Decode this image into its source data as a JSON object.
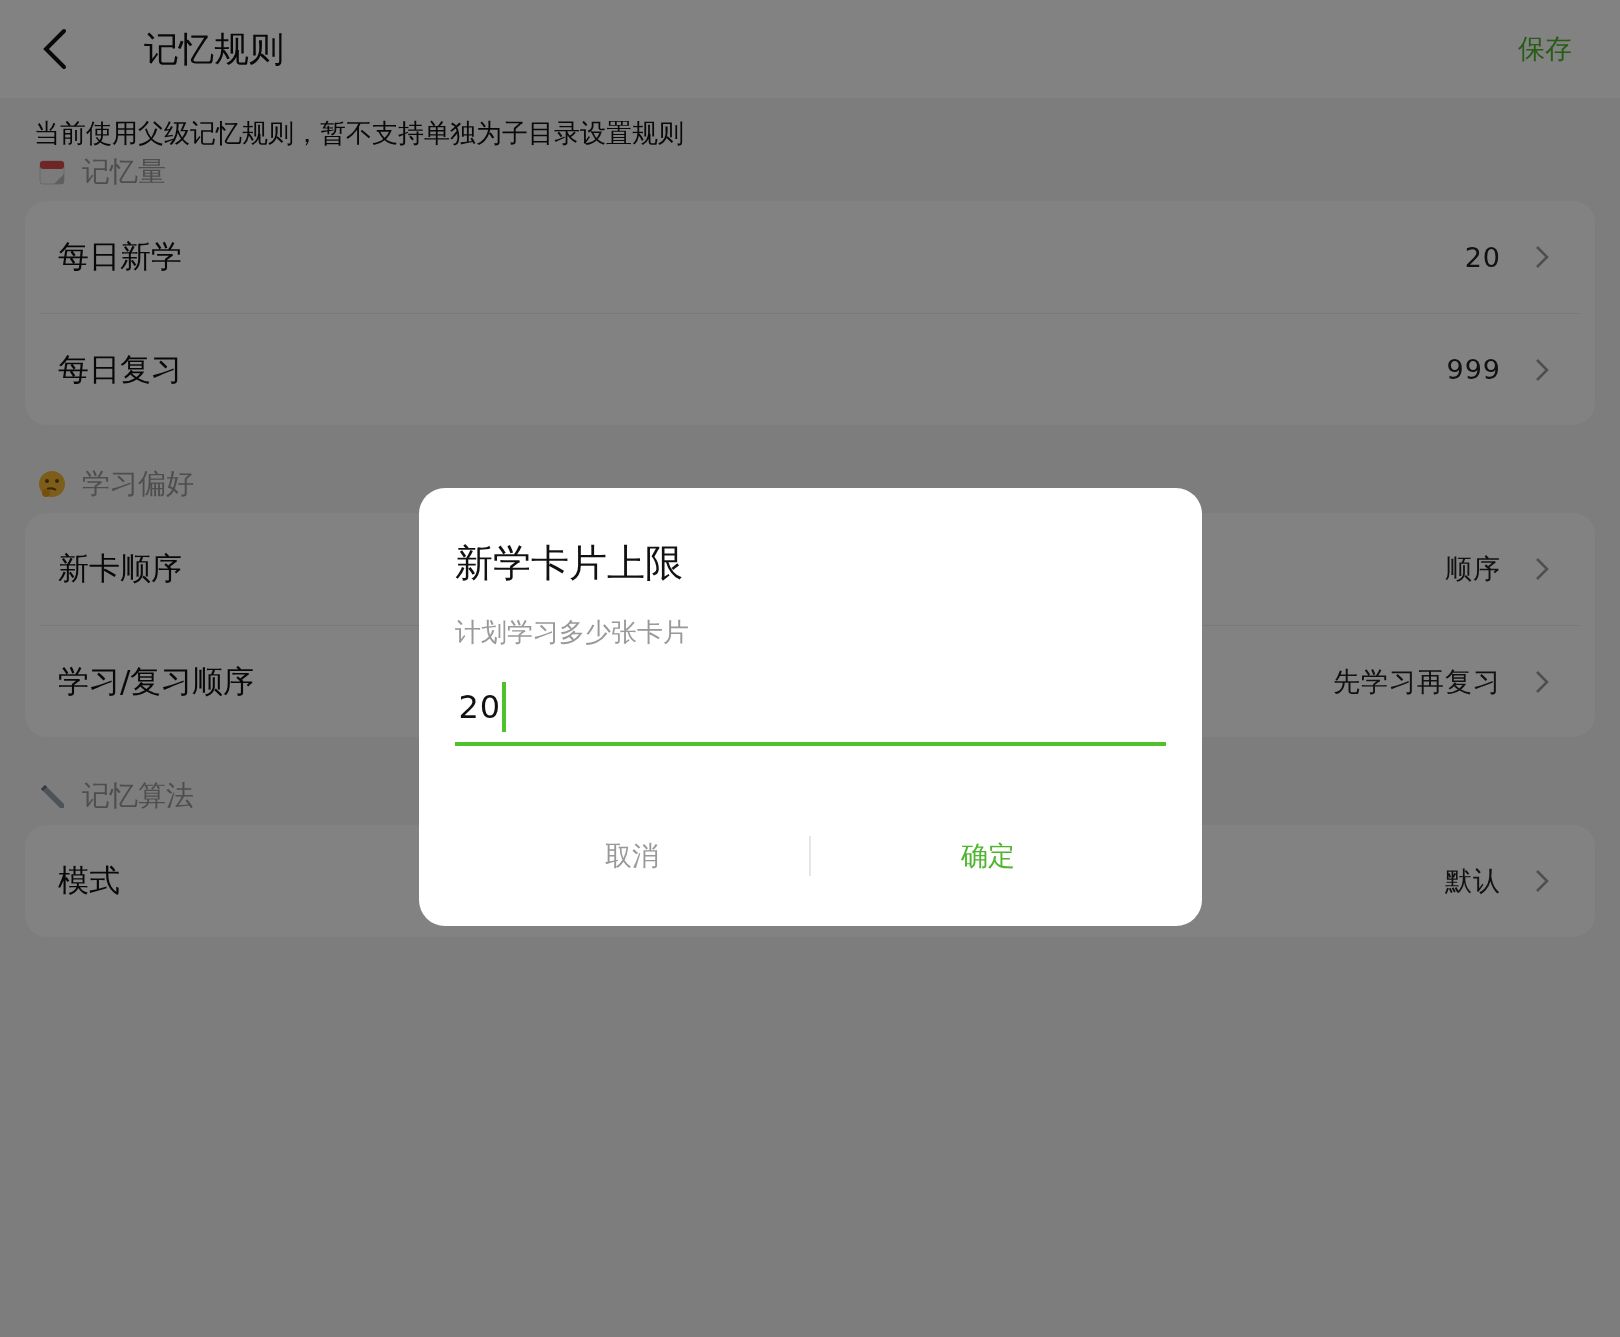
{
  "header": {
    "title": "记忆规则",
    "action": "保存"
  },
  "notice": "当前使用父级记忆规则，暂不支持单独为子目录设置规则",
  "sections": [
    {
      "title": "记忆量",
      "kind": "calendar",
      "rows": [
        {
          "label": "每日新学",
          "value": "20"
        },
        {
          "label": "每日复习",
          "value": "999"
        }
      ]
    },
    {
      "title": "学习偏好",
      "kind": "face",
      "rows": [
        {
          "label": "新卡顺序",
          "value": "顺序"
        },
        {
          "label": "学习/复习顺序",
          "value": "先学习再复习"
        }
      ]
    },
    {
      "title": "记忆算法",
      "kind": "pencil",
      "rows": [
        {
          "label": "模式",
          "value": "默认"
        }
      ]
    }
  ],
  "dialog": {
    "title": "新学卡片上限",
    "subtitle": "计划学习多少张卡片",
    "value": "20",
    "buttons": [
      {
        "label": "取消",
        "kind": "cancel"
      },
      {
        "label": "确定",
        "kind": "confirm"
      }
    ]
  }
}
